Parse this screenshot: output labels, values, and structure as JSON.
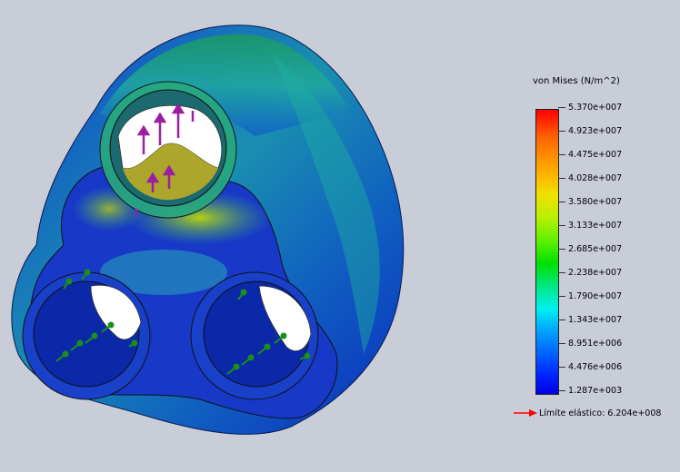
{
  "legend": {
    "title": "von Mises (N/m^2)",
    "ticks": [
      "5.370e+007",
      "4.923e+007",
      "4.475e+007",
      "4.028e+007",
      "3.580e+007",
      "3.133e+007",
      "2.685e+007",
      "2.238e+007",
      "1.790e+007",
      "1.343e+007",
      "8.951e+006",
      "4.476e+006",
      "1.287e+003"
    ],
    "yield_label": "Límite elástico: 6.204e+008",
    "yield_arrow_color": "#ff0000",
    "colors": {
      "max": "#ff0000",
      "min": "#0000e0",
      "load_arrow": "#9b1fa0",
      "fixture": "#1a8f1a"
    }
  }
}
